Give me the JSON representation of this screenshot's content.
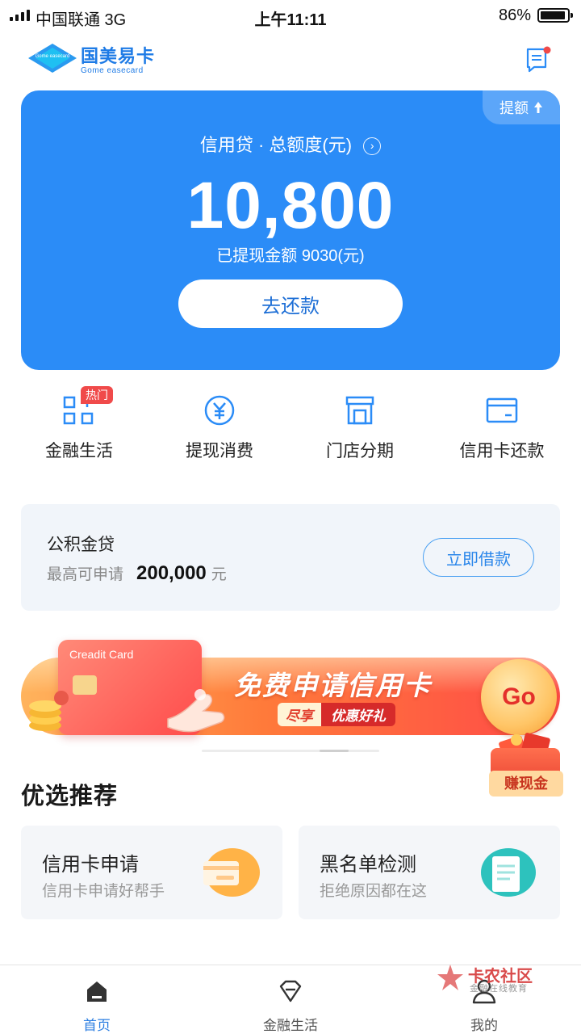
{
  "status_bar": {
    "carrier": "中国联通   3G",
    "time": "上午11:11",
    "battery": "86%"
  },
  "header": {
    "logo_cn": "国美易卡",
    "logo_en": "Gome easecard",
    "logo_mark_text": "Gome easecard",
    "message_icon": "message-icon"
  },
  "credit_card": {
    "raise_label": "提额",
    "title": "信用贷 · 总额度(元)",
    "amount": "10,800",
    "withdrawn": "已提现金额 9030(元)",
    "repay_label": "去还款"
  },
  "quick_actions": {
    "hot_badge": "热门",
    "items": [
      {
        "label": "金融生活",
        "icon": "grid-icon"
      },
      {
        "label": "提现消费",
        "icon": "yuan-icon"
      },
      {
        "label": "门店分期",
        "icon": "store-icon"
      },
      {
        "label": "信用卡还款",
        "icon": "card-icon"
      }
    ]
  },
  "fund_loan": {
    "title": "公积金贷",
    "sub_label": "最高可申请",
    "amount": "200,000",
    "unit": "元",
    "borrow_label": "立即借款"
  },
  "banner": {
    "card_label": "Creadit Card",
    "headline": "免费申请信用卡",
    "sub_a": "尽享",
    "sub_b": "优惠好礼",
    "go_label": "Go"
  },
  "cash_float": {
    "label": "赚现金"
  },
  "recommendations": {
    "title": "优选推荐",
    "items": [
      {
        "name": "信用卡申请",
        "desc": "信用卡申请好帮手",
        "icon": "credit-card-icon"
      },
      {
        "name": "黑名单检测",
        "desc": "拒绝原因都在这",
        "icon": "document-icon"
      }
    ]
  },
  "watermark": {
    "title": "卡农社区",
    "sub": "金融在线教育"
  },
  "bottom_nav": {
    "items": [
      {
        "label": "首页",
        "icon": "home-icon",
        "active": true
      },
      {
        "label": "金融生活",
        "icon": "diamond-icon",
        "active": false
      },
      {
        "label": "我的",
        "icon": "user-icon",
        "active": false
      }
    ]
  },
  "colors": {
    "primary": "#2b8cf7",
    "accent_text": "#2a86ea",
    "hot": "#f04a4a",
    "banner_orange": "#ff7a3a"
  }
}
